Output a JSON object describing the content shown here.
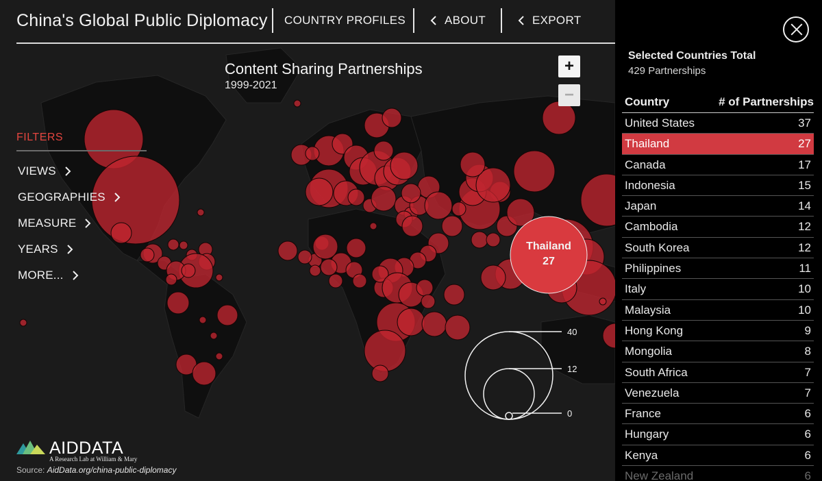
{
  "header": {
    "title": "China's Global Public Diplomacy",
    "nav": {
      "country_profiles": "COUNTRY PROFILES",
      "about": "ABOUT",
      "export": "EXPORT"
    }
  },
  "map": {
    "title": "Content Sharing Partnerships",
    "subtitle": "1999-2021",
    "zoom_in": "+",
    "zoom_out": "−",
    "highlight": {
      "country": "Thailand",
      "value": "27"
    },
    "legend": {
      "labels": [
        "40",
        "12",
        "0"
      ]
    },
    "colors": {
      "bubble_fill": "#c0252f",
      "bubble_highlight": "#d93a3f",
      "background": "#1b1b1b",
      "land": "#0f0f0f"
    }
  },
  "filters": {
    "title": "FILTERS",
    "items": [
      "VIEWS",
      "GEOGRAPHIES",
      "MEASURE",
      "YEARS",
      "MORE..."
    ]
  },
  "footer": {
    "logo_text": "AIDDATA",
    "logo_tagline": "A Research Lab at William & Mary",
    "source_label": "Source:",
    "source_url": "AidData.org/china-public-diplomacy"
  },
  "panel": {
    "selected_title": "Selected Countries Total",
    "selected_total": "429 Partnerships",
    "col_country": "Country",
    "col_partnerships": "# of Partnerships",
    "rows": [
      {
        "country": "United States",
        "value": "37"
      },
      {
        "country": "Thailand",
        "value": "27"
      },
      {
        "country": "Canada",
        "value": "17"
      },
      {
        "country": "Indonesia",
        "value": "15"
      },
      {
        "country": "Japan",
        "value": "14"
      },
      {
        "country": "Cambodia",
        "value": "12"
      },
      {
        "country": "South Korea",
        "value": "12"
      },
      {
        "country": "Philippines",
        "value": "11"
      },
      {
        "country": "Italy",
        "value": "10"
      },
      {
        "country": "Malaysia",
        "value": "10"
      },
      {
        "country": "Hong Kong",
        "value": "9"
      },
      {
        "country": "Mongolia",
        "value": "8"
      },
      {
        "country": "South Africa",
        "value": "7"
      },
      {
        "country": "Venezuela",
        "value": "7"
      },
      {
        "country": "France",
        "value": "6"
      },
      {
        "country": "Hungary",
        "value": "6"
      },
      {
        "country": "Kenya",
        "value": "6"
      },
      {
        "country": "New Zealand",
        "value": "6"
      }
    ],
    "selected_country": "Thailand"
  }
}
